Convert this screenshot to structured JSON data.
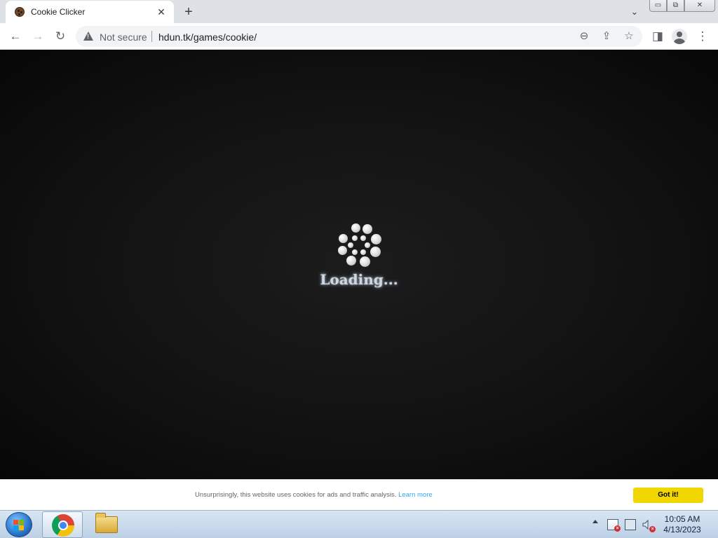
{
  "browser": {
    "tab": {
      "title": "Cookie Clicker",
      "favicon": "cookie-icon",
      "close_glyph": "✕"
    },
    "new_tab_glyph": "+",
    "tab_search_glyph": "⌄",
    "window_controls": {
      "minimize": "▭",
      "restore": "⧉",
      "close": "✕"
    },
    "toolbar": {
      "back_glyph": "←",
      "forward_glyph": "→",
      "reload_glyph": "↻",
      "security_label": "Not secure",
      "url": "hdun.tk/games/cookie/",
      "zoom_glyph": "⊖",
      "share_glyph": "⇪",
      "bookmark_glyph": "☆",
      "sidepanel_glyph": "◨",
      "menu_glyph": "⋮"
    }
  },
  "page": {
    "loading_text": "Loading...",
    "background_color": "#111111",
    "cookie_banner": {
      "message": "Unsurprisingly, this website uses cookies for ads and traffic analysis.",
      "learn_more": "Learn more",
      "accept_label": "Got it!",
      "accept_color": "#f1d600",
      "link_color": "#31a8f0"
    }
  },
  "taskbar": {
    "pinned": [
      "chrome-icon",
      "file-explorer-icon"
    ],
    "clock": {
      "time": "10:05 AM",
      "date": "4/13/2023"
    }
  }
}
